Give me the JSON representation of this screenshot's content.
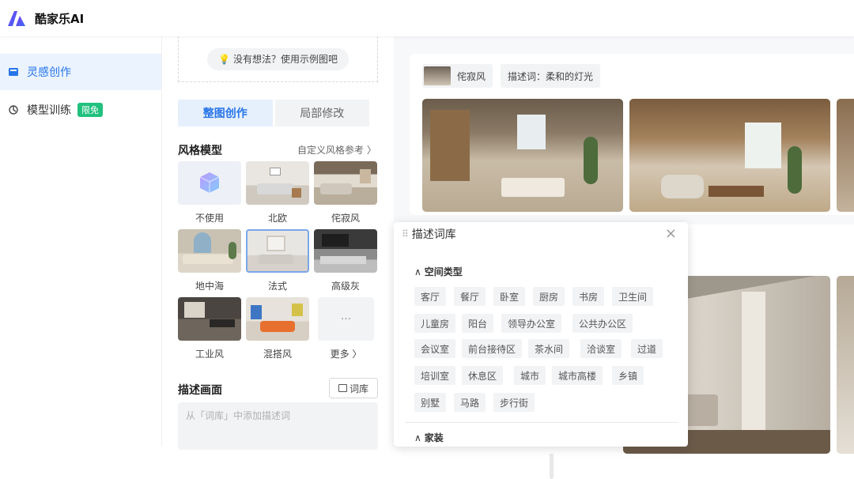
{
  "app": {
    "brand": "酷家乐AI"
  },
  "sidebar": {
    "items": [
      {
        "label": "灵感创作",
        "icon": "image-icon",
        "active": true
      },
      {
        "label": "模型训练",
        "icon": "model-icon",
        "badge": "限免"
      }
    ]
  },
  "panel": {
    "example_button": "没有想法？使用示例图吧",
    "tabs": [
      {
        "label": "整图创作",
        "active": true
      },
      {
        "label": "局部修改"
      }
    ],
    "style_section": {
      "title": "风格模型",
      "link": "自定义风格参考 〉"
    },
    "styles": [
      {
        "label": "不使用"
      },
      {
        "label": "北欧"
      },
      {
        "label": "侘寂风"
      },
      {
        "label": "地中海"
      },
      {
        "label": "法式",
        "selected": true
      },
      {
        "label": "高级灰"
      },
      {
        "label": "工业风"
      },
      {
        "label": "混搭风"
      },
      {
        "label": "更多 〉"
      }
    ],
    "describe": {
      "title": "描述画面",
      "words_button": "词库",
      "placeholder": "从「词库」中添加描述词"
    }
  },
  "results": {
    "chips": [
      "侘寂风",
      "描述词：柔和的灯光"
    ]
  },
  "word_library": {
    "title": "描述词库",
    "categories": [
      {
        "name": "空间类型",
        "tags": [
          "客厅",
          "餐厅",
          "卧室",
          "厨房",
          "书房",
          "卫生间",
          "儿童房",
          "阳台",
          "领导办公室",
          "公共办公区",
          "会议室",
          "前台接待区",
          "茶水间",
          "洽谈室",
          "过道",
          "培训室",
          "休息区",
          "城市",
          "城市高楼",
          "乡镇",
          "别墅",
          "马路",
          "步行街"
        ]
      },
      {
        "name": "家装",
        "tags": []
      }
    ]
  },
  "colors": {
    "accent": "#2775e8",
    "badge": "#21c17e",
    "active_bg": "#eaf3fe"
  }
}
